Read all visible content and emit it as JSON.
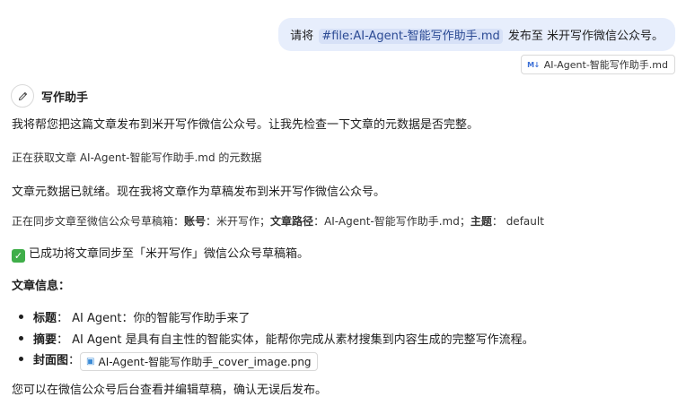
{
  "user_message": {
    "prefix": "请将 ",
    "file_ref": "#file:AI-Agent-智能写作助手.md",
    "suffix": " 发布至 米开写作微信公众号。",
    "attachment": "AI-Agent-智能写作助手.md",
    "attachment_icon": "M↓"
  },
  "assistant": {
    "name": "写作助手",
    "intro": "我将帮您把这篇文章发布到米开写作微信公众号。让我先检查一下文章的元数据是否完整。",
    "fetching": "正在获取文章 AI-Agent-智能写作助手.md 的元数据",
    "ready": "文章元数据已就绪。现在我将文章作为草稿发布到米开写作微信公众号。",
    "sync": {
      "prefix": "正在同步文章至微信公众号草稿箱：",
      "account_label": "账号",
      "account_value": "：米开写作；",
      "path_label": "文章路径",
      "path_value": "：AI-Agent-智能写作助手.md；",
      "theme_label": "主题",
      "theme_value": "： default"
    },
    "success": "已成功将文章同步至「米开写作」微信公众号草稿箱。",
    "info_heading": "文章信息：",
    "items": {
      "title_label": "标题",
      "title_value": "： AI Agent：你的智能写作助手来了",
      "summary_label": "摘要",
      "summary_value": "： AI Agent 是具有自主性的智能实体，能帮你完成从素材搜集到内容生成的完整写作流程。",
      "cover_label": "封面图",
      "cover_sep": "：",
      "cover_file": "AI-Agent-智能写作助手_cover_image.png"
    },
    "footer": "您可以在微信公众号后台查看并编辑草稿，确认无误后发布。"
  }
}
